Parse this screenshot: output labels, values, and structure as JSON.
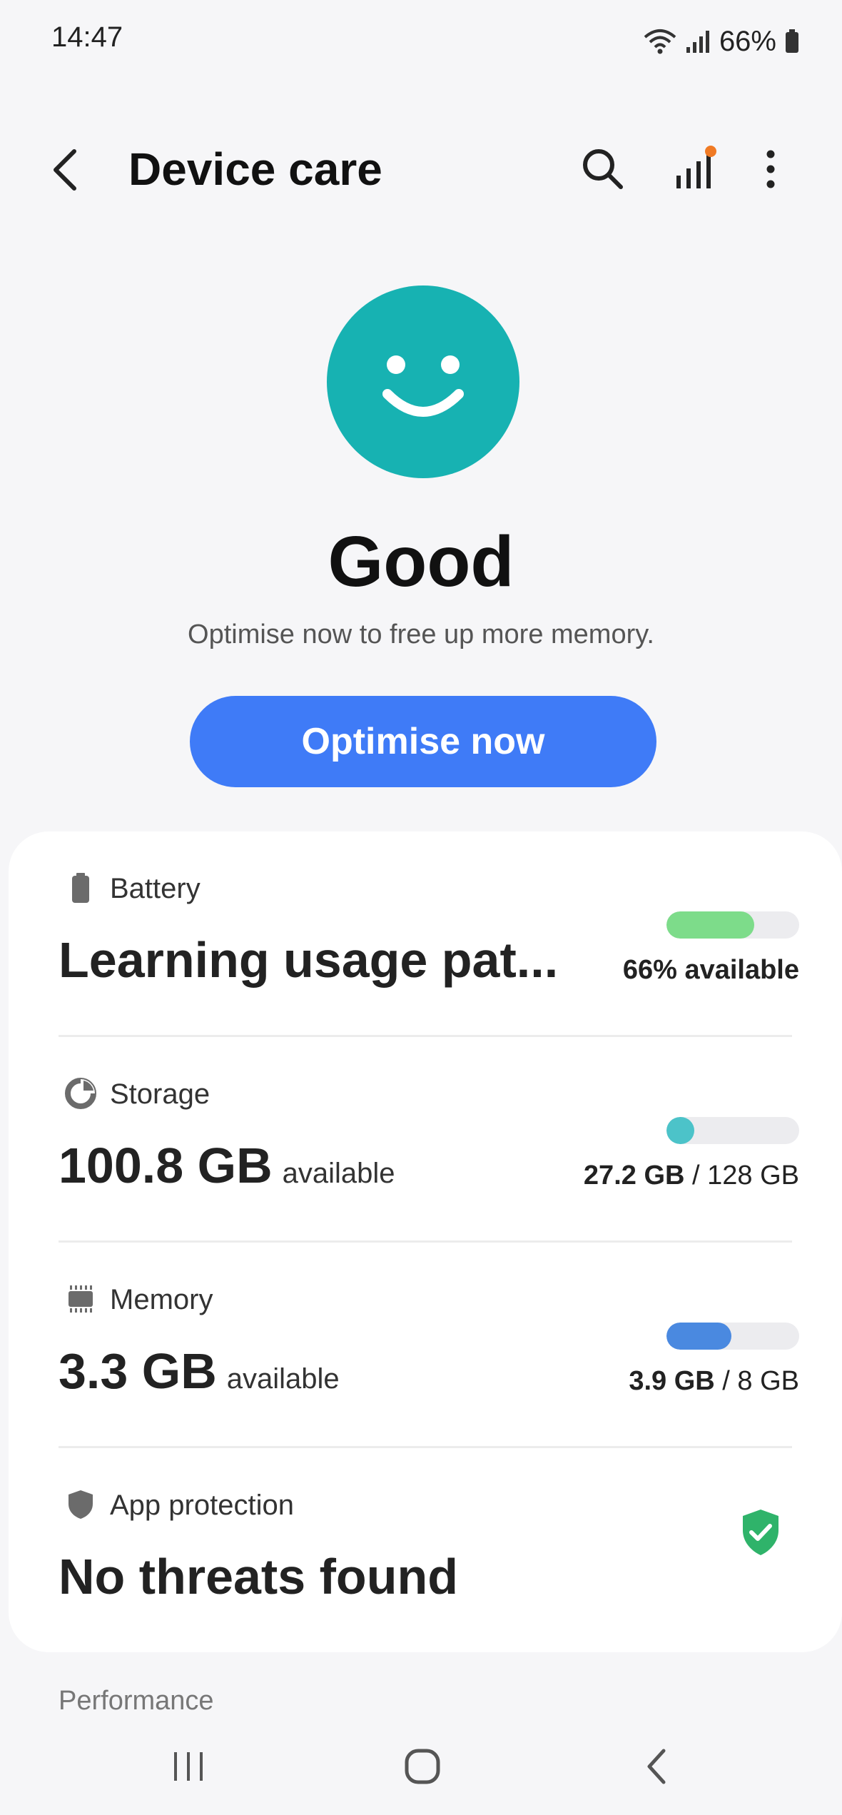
{
  "status_bar": {
    "time": "14:47",
    "battery": "66%",
    "icons": [
      "wifi-icon",
      "signal-icon",
      "battery-icon"
    ]
  },
  "app_bar": {
    "title": "Device care",
    "icons": [
      "back-icon",
      "search-icon",
      "stats-icon",
      "more-icon"
    ],
    "notification_dot_color": "#f07a24"
  },
  "summary": {
    "status": "Good",
    "message": "Optimise now to free up more memory.",
    "face_color": "#17b2b2",
    "button_label": "Optimise now",
    "button_color": "#3f7bf7"
  },
  "items": {
    "battery": {
      "label": "Battery",
      "main": "Learning usage pat...",
      "right": "66% available",
      "percent": 66,
      "color": "#7ddc8a",
      "icon": "battery-icon"
    },
    "storage": {
      "label": "Storage",
      "main": "100.8 GB",
      "suffix": "available",
      "used": "27.2 GB",
      "total": "/ 128 GB",
      "percent": 21,
      "color": "#4cc3c9",
      "icon": "pie-icon"
    },
    "memory": {
      "label": "Memory",
      "main": "3.3 GB",
      "suffix": "available",
      "used": "3.9 GB",
      "total": "/ 8 GB",
      "percent": 49,
      "color": "#4a89e0",
      "icon": "chip-icon"
    },
    "protection": {
      "label": "App protection",
      "main": "No threats found",
      "icon": "shield-icon",
      "status_color": "#2fb36a"
    }
  },
  "next_section": {
    "label": "Performance"
  },
  "nav": {
    "icons": [
      "recents-icon",
      "home-icon",
      "back-nav-icon"
    ]
  }
}
